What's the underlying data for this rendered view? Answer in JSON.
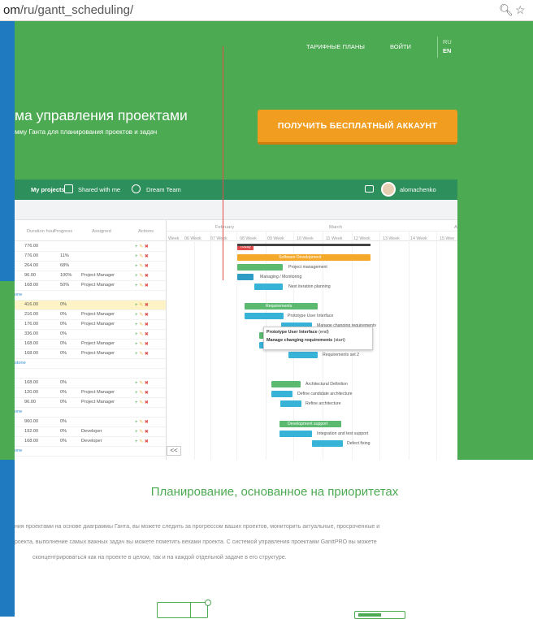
{
  "browser": {
    "url_prefix": "om",
    "url_path": "/ru/gantt_scheduling/",
    "zoom_icon": "zoom-icon",
    "star_icon": "star-icon"
  },
  "nav": {
    "plans": "ТАРИФНЫЕ ПЛАНЫ",
    "login": "ВОЙТИ",
    "lang_ru": "RU",
    "lang_en": "EN"
  },
  "hero": {
    "title": "ма управления проектами",
    "subtitle": "мму Ганта для планирования проектов и задач",
    "cta": "ПОЛУЧИТЬ БЕСПЛАТНЫЙ АККАУНТ"
  },
  "app": {
    "tabs": [
      "My projects",
      "Shared with me",
      "Dream Team"
    ],
    "username": "alomachenko",
    "columns": [
      "Duration hour",
      "Progress",
      "Assigned",
      "Actions"
    ],
    "months": [
      "February",
      "March",
      "A"
    ],
    "weeks": [
      "Week",
      "06 Week",
      "07 Week",
      "08 Week",
      "09 Week",
      "10 Week",
      "11 Week",
      "12 Week",
      "13 Week",
      "14 Week",
      "15 Wee"
    ],
    "today_label": "Today",
    "rows": [
      {
        "c0": "",
        "dur": "776.00",
        "prog": "",
        "assigned": ""
      },
      {
        "c0": "",
        "dur": "776.00",
        "prog": "11%",
        "assigned": ""
      },
      {
        "c0": "",
        "dur": "264.00",
        "prog": "68%",
        "assigned": ""
      },
      {
        "c0": "",
        "dur": "96.00",
        "prog": "100%",
        "assigned": "Project Manager"
      },
      {
        "c0": "",
        "dur": "168.00",
        "prog": "50%",
        "assigned": "Project Manager"
      },
      {
        "c0": "one",
        "dur": "",
        "prog": "",
        "assigned": ""
      },
      {
        "c0": "",
        "dur": "416.00",
        "prog": "0%",
        "assigned": ""
      },
      {
        "c0": "",
        "dur": "216.00",
        "prog": "0%",
        "assigned": "Project Manager"
      },
      {
        "c0": "",
        "dur": "176.00",
        "prog": "0%",
        "assigned": "Project Manager"
      },
      {
        "c0": "",
        "dur": "336.00",
        "prog": "0%",
        "assigned": ""
      },
      {
        "c0": "",
        "dur": "168.00",
        "prog": "0%",
        "assigned": "Project Manager"
      },
      {
        "c0": "",
        "dur": "168.00",
        "prog": "0%",
        "assigned": "Project Manager"
      },
      {
        "c0": "stone",
        "dur": "",
        "prog": "",
        "assigned": ""
      },
      {
        "c0": "",
        "dur": "",
        "prog": "",
        "assigned": ""
      },
      {
        "c0": "",
        "dur": "168.00",
        "prog": "0%",
        "assigned": ""
      },
      {
        "c0": "",
        "dur": "120.00",
        "prog": "0%",
        "assigned": "Project Manager"
      },
      {
        "c0": "",
        "dur": "96.00",
        "prog": "0%",
        "assigned": "Project Manager"
      },
      {
        "c0": "one",
        "dur": "",
        "prog": "",
        "assigned": ""
      },
      {
        "c0": "",
        "dur": "960.00",
        "prog": "0%",
        "assigned": ""
      },
      {
        "c0": "",
        "dur": "192.00",
        "prog": "0%",
        "assigned": "Developer"
      },
      {
        "c0": "",
        "dur": "168.00",
        "prog": "0%",
        "assigned": "Developer"
      },
      {
        "c0": "one",
        "dur": "",
        "prog": "",
        "assigned": ""
      }
    ],
    "task_labels": {
      "software_dev": "Software Development",
      "project_mgmt": "Project management",
      "managing": "Managing / Monitoring",
      "next_iter": "Next iteration planning",
      "requirements": "Requirements",
      "prototype_ui": "Prototype User Interface",
      "manage_changing": "Manage changing requirements",
      "requirements_set2": "Requirements set 2",
      "arch_def": "Architectural Definition",
      "define_arch": "Define candidate architecture",
      "refine_arch": "Refine architecture",
      "dev_support": "Development support",
      "integration": "Integration and test support",
      "defect": "Defect fixing"
    },
    "tooltip": {
      "line1_bold": "Prototype User Interface",
      "line1_rest": " (end)",
      "line2_bold": "Manage changing requirements",
      "line2_rest": " (start)"
    },
    "collapse": "<<"
  },
  "section": {
    "title": "Планирование, основанное на приоритетах",
    "p1": "ния проектами на основе диаграммы Ганта, вы можете следить за прогрессом ваших проектов, мониторить актуальные, просроченные и",
    "p2": "роекта, выполнение самых важных задач вы можете пометить вехами проекта. С системой управления проектами GanttPRO вы можете",
    "p3": "сконцентрироваться как на проекте в целом, так и на каждой отдельной задаче в его структуре."
  },
  "colors": {
    "green": "#4caa52",
    "dark_green": "#2d8f5b",
    "orange": "#f19d20",
    "blue": "#1f7ac0",
    "task_blue": "#38b3d8",
    "task_green": "#5bba6f"
  }
}
